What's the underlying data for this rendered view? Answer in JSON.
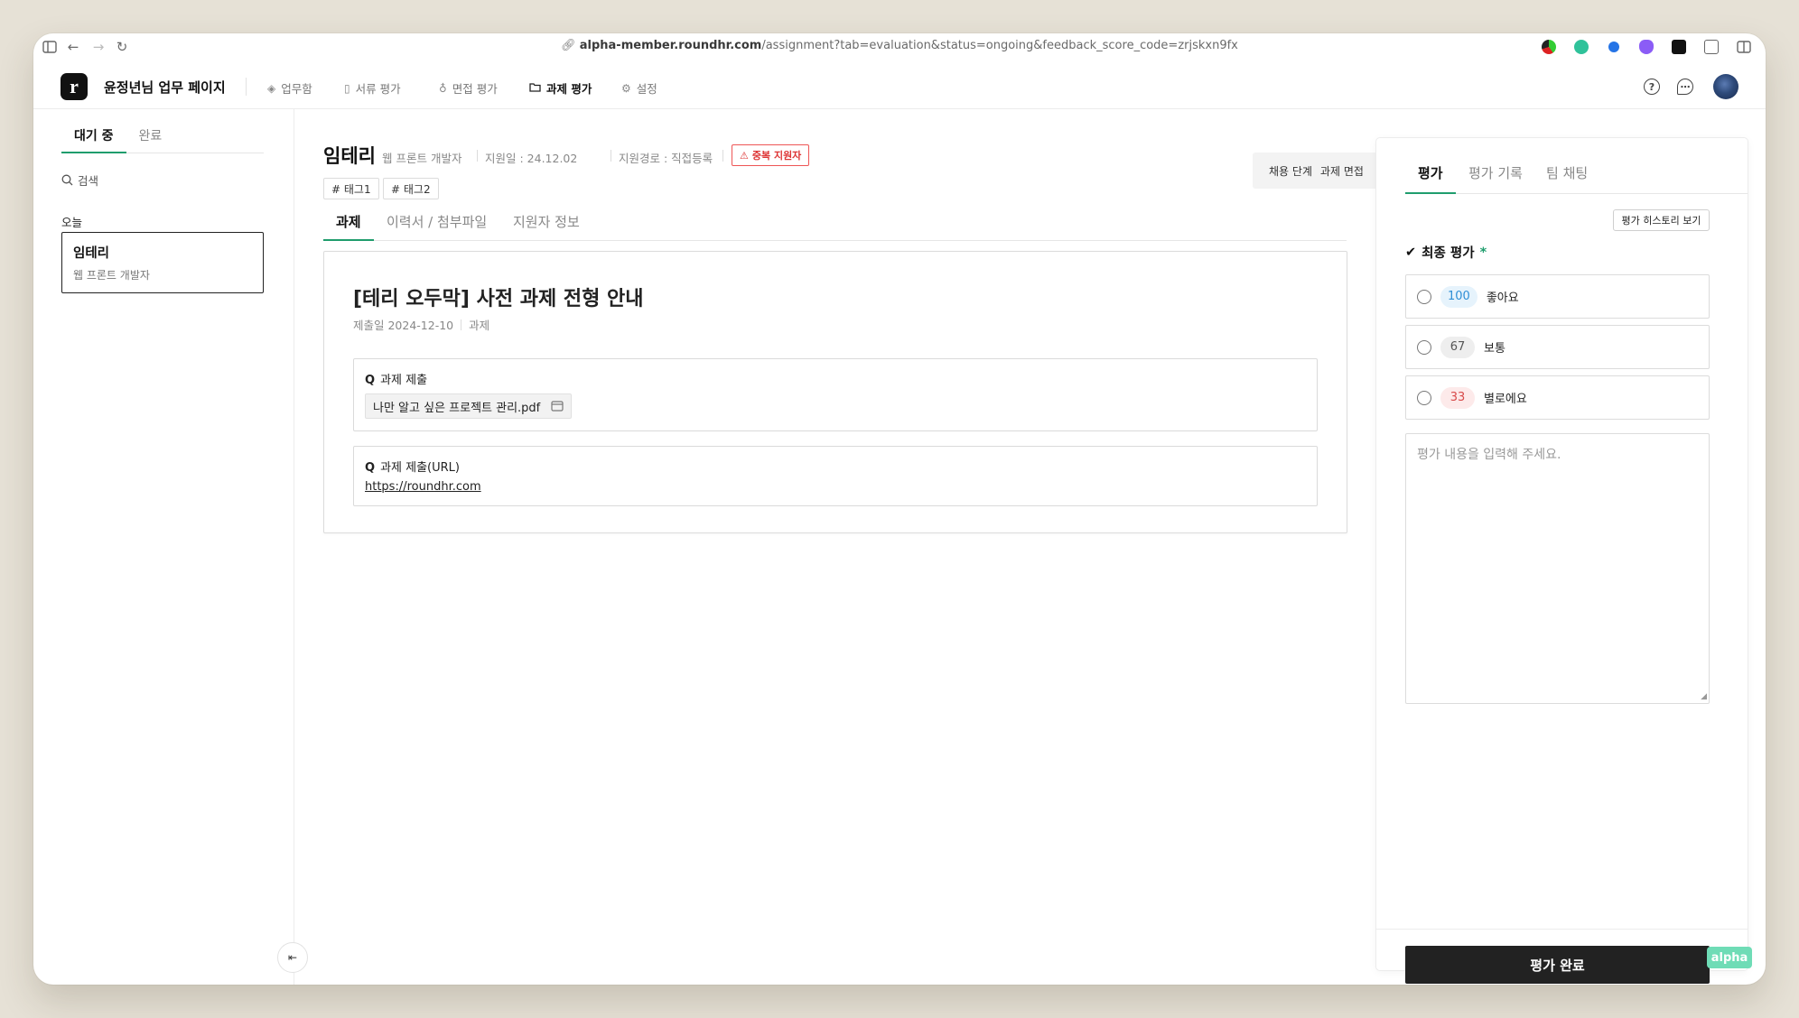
{
  "browser": {
    "url_host": "alpha-member.roundhr.com",
    "url_path": "/assignment?tab=evaluation&status=ongoing&feedback_score_code=zrjskxn9fx"
  },
  "header": {
    "logo": "r",
    "title": "윤정년님 업무 페이지",
    "nav": [
      {
        "label": "업무함",
        "icon": "layers-icon"
      },
      {
        "label": "서류 평가",
        "icon": "document-icon"
      },
      {
        "label": "면접 평가",
        "icon": "microphone-icon"
      },
      {
        "label": "과제 평가",
        "icon": "folder-icon"
      },
      {
        "label": "설정",
        "icon": "gear-icon"
      }
    ],
    "active_nav": "과제 평가"
  },
  "sidebar": {
    "tabs": [
      "대기 중",
      "완료"
    ],
    "active_tab": "대기 중",
    "search_placeholder": "검색",
    "group_label": "오늘",
    "candidates": [
      {
        "name": "임테리",
        "role": "웹 프론트 개발자"
      }
    ]
  },
  "candidate": {
    "name": "임테리",
    "role": "웹 프론트 개발자",
    "applied": "지원일 : 24.12.02",
    "route": "지원경로 : 직접등록",
    "duplicate_badge": "중복 지원자",
    "tags": [
      "# 태그1",
      "# 태그2"
    ],
    "stage_label": "채용 단계",
    "stage_value": "과제 면접"
  },
  "main_tabs": [
    "과제",
    "이력서 / 첨부파일",
    "지원자 정보"
  ],
  "active_main_tab": "과제",
  "task": {
    "title": "[테리 오두막] 사전 과제 전형 안내",
    "submitted": "제출일 2024-12-10",
    "type": "과제",
    "questions": [
      {
        "q": "Q",
        "label": "과제 제출",
        "file": "나만 알고 싶은 프로젝트 관리.pdf"
      },
      {
        "q": "Q",
        "label": "과제 제출(URL)",
        "url": "https://roundhr.com"
      }
    ]
  },
  "panel": {
    "tabs": [
      "평가",
      "평가 기록",
      "팀 채팅"
    ],
    "active_tab": "평가",
    "history_button": "평가 히스토리 보기",
    "final_label": "최종 평가",
    "required_mark": "*",
    "options": [
      {
        "score": "100",
        "label": "좋아요",
        "score_color": "#2f8fd6",
        "score_bg": "#e6f3fc"
      },
      {
        "score": "67",
        "label": "보통",
        "score_color": "#555555",
        "score_bg": "#eeeeee"
      },
      {
        "score": "33",
        "label": "별로에요",
        "score_color": "#d84a4a",
        "score_bg": "#fdeaea"
      }
    ],
    "textarea_placeholder": "평가 내용을 입력해 주세요.",
    "submit_label": "평가 완료"
  },
  "env_badge": "alpha",
  "colors": {
    "accent": "#1f9d6d",
    "danger": "#dd3333"
  }
}
